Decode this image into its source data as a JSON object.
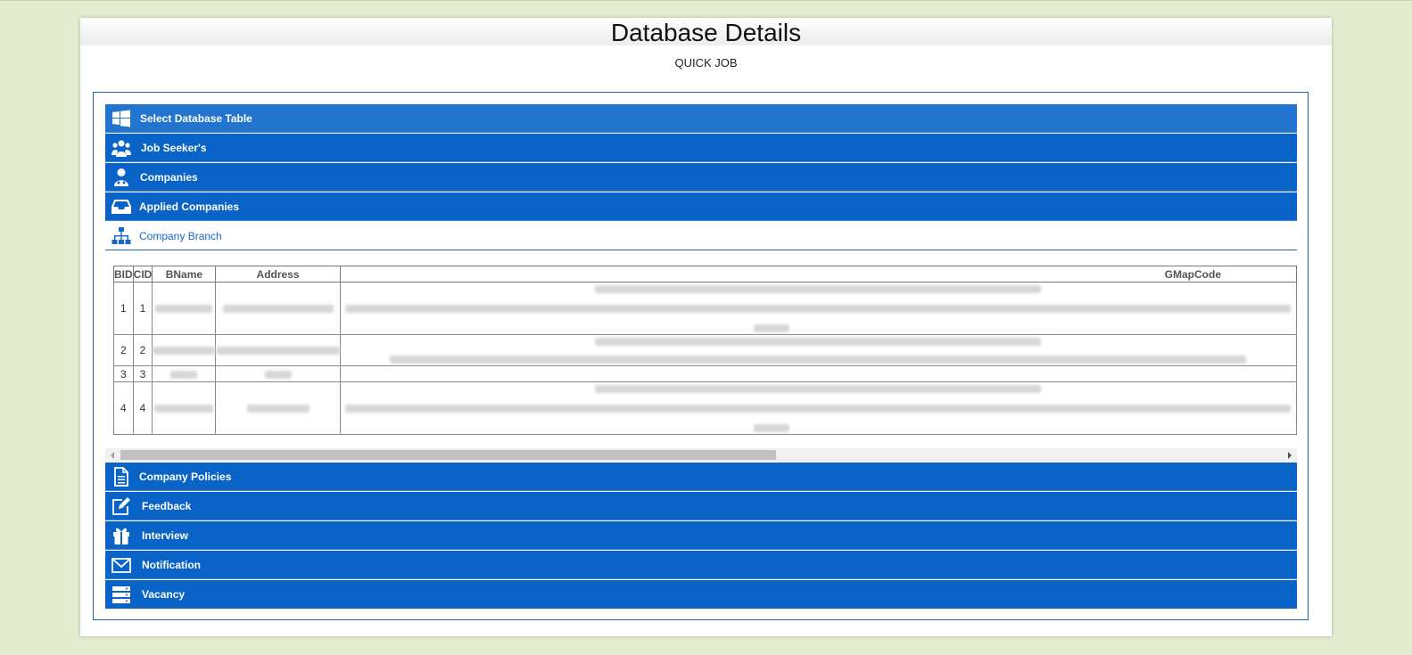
{
  "page": {
    "title": "Database Details",
    "subtitle": "QUICK JOB"
  },
  "colors": {
    "accent": "#0a64c8",
    "header_row": "#2274cf",
    "background": "#e4ecd0"
  },
  "accordion": {
    "items": [
      {
        "label": "Select Database Table",
        "icon": "windows-icon"
      },
      {
        "label": "Job Seeker's",
        "icon": "users-group-icon"
      },
      {
        "label": "Companies",
        "icon": "user-doctor-icon"
      },
      {
        "label": "Applied Companies",
        "icon": "inbox-icon"
      },
      {
        "label": "Company Branch",
        "icon": "sitemap-icon",
        "expanded": true
      },
      {
        "label": "Company Policies",
        "icon": "document-icon"
      },
      {
        "label": "Feedback",
        "icon": "edit-icon"
      },
      {
        "label": "Interview",
        "icon": "gift-icon"
      },
      {
        "label": "Notification",
        "icon": "envelope-icon"
      },
      {
        "label": "Vacancy",
        "icon": "server-icon"
      }
    ]
  },
  "branch_table": {
    "columns": [
      "BID",
      "CID",
      "BName",
      "Address",
      "GMapCode"
    ],
    "rows": [
      {
        "bid": "1",
        "cid": "1"
      },
      {
        "bid": "2",
        "cid": "2"
      },
      {
        "bid": "3",
        "cid": "3"
      },
      {
        "bid": "4",
        "cid": "4"
      }
    ]
  }
}
